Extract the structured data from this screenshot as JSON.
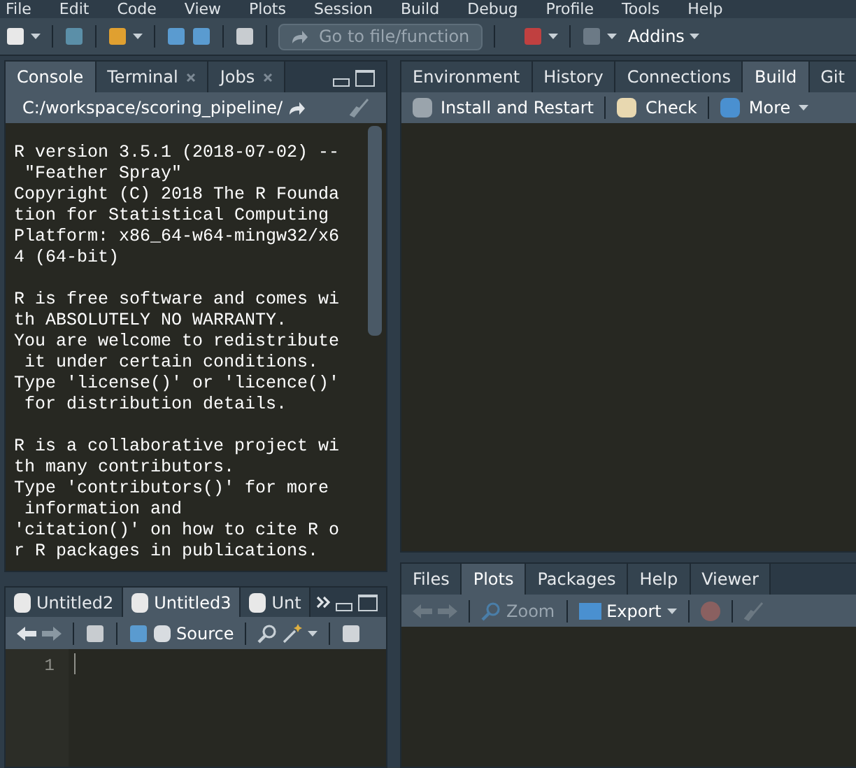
{
  "menu": [
    "File",
    "Edit",
    "Code",
    "View",
    "Plots",
    "Session",
    "Build",
    "Debug",
    "Profile",
    "Tools",
    "Help"
  ],
  "toolbar": {
    "goto_placeholder": "Go to file/function",
    "addins": "Addins"
  },
  "console_pane": {
    "tabs": [
      {
        "label": "Console",
        "selected": true,
        "closable": false
      },
      {
        "label": "Terminal",
        "selected": false,
        "closable": true
      },
      {
        "label": "Jobs",
        "selected": false,
        "closable": true
      }
    ],
    "path": "C:/workspace/scoring_pipeline/",
    "paragraphs": [
      [
        "R version 3.5.1 (2018-07-02) --",
        " \"Feather Spray\"",
        "Copyright (C) 2018 The R Founda",
        "tion for Statistical Computing",
        "Platform: x86_64-w64-mingw32/x6",
        "4 (64-bit)"
      ],
      [
        "R is free software and comes wi",
        "th ABSOLUTELY NO WARRANTY.",
        "You are welcome to redistribute",
        " it under certain conditions.",
        "Type 'license()' or 'licence()'",
        " for distribution details."
      ],
      [
        "R is a collaborative project wi",
        "th many contributors.",
        "Type 'contributors()' for more",
        " information and",
        "'citation()' on how to cite R o",
        "r R packages in publications."
      ]
    ]
  },
  "editor_pane": {
    "tabs": [
      {
        "label": "Untitled2",
        "selected": false
      },
      {
        "label": "Untitled3",
        "selected": true
      },
      {
        "label": "Unt",
        "selected": false
      }
    ],
    "source_label": "Source",
    "source_on_save": false,
    "line_numbers": [
      "1"
    ]
  },
  "env_pane": {
    "tabs": [
      {
        "label": "Environment",
        "selected": false
      },
      {
        "label": "History",
        "selected": false
      },
      {
        "label": "Connections",
        "selected": false
      },
      {
        "label": "Build",
        "selected": true
      },
      {
        "label": "Git",
        "selected": false
      }
    ],
    "actions": [
      "Install and Restart",
      "Check",
      "More"
    ]
  },
  "files_pane": {
    "tabs": [
      {
        "label": "Files",
        "selected": false
      },
      {
        "label": "Plots",
        "selected": true
      },
      {
        "label": "Packages",
        "selected": false
      },
      {
        "label": "Help",
        "selected": false
      },
      {
        "label": "Viewer",
        "selected": false
      }
    ],
    "zoom": "Zoom",
    "export": "Export"
  }
}
